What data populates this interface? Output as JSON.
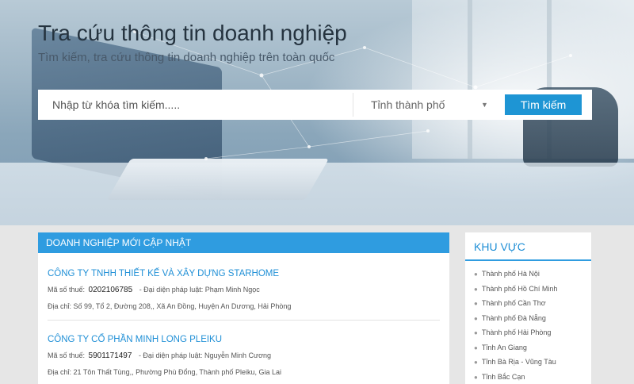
{
  "hero": {
    "title": "Tra cứu thông tin doanh nghiệp",
    "subtitle": "Tìm kiếm, tra cứu thông tin doanh nghiệp trên toàn quốc"
  },
  "search": {
    "placeholder": "Nhập từ khóa tìm kiếm.....",
    "province_select": "Tỉnh thành phố",
    "button": "Tìm kiếm"
  },
  "updates": {
    "header": "DOANH NGHIỆP MỚI CẬP NHẬT",
    "companies": [
      {
        "name": "CÔNG TY TNHH THIẾT KẾ VÀ XÂY DỰNG STARHOME",
        "tax_label": "Mã số thuế:",
        "tax_code": "0202106785",
        "rep_label": "- Đại diện pháp luật:",
        "rep_name": "Phạm Minh Ngọc",
        "address_label": "Địa chỉ:",
        "address": "Số 99, Tổ 2, Đường 208,, Xã An Đồng, Huyện An Dương, Hải Phòng"
      },
      {
        "name": "CÔNG TY CỔ PHẦN MINH LONG PLEIKU",
        "tax_label": "Mã số thuế:",
        "tax_code": "5901171497",
        "rep_label": "- Đại diện pháp luật:",
        "rep_name": "Nguyễn Minh Cương",
        "address_label": "Địa chỉ:",
        "address": "21 Tôn Thất Tùng,, Phường Phù Đổng, Thành phố Pleiku, Gia Lai"
      }
    ]
  },
  "sidebar": {
    "title": "KHU VỰC",
    "regions": [
      "Thành phố Hà Nội",
      "Thành phố Hồ Chí Minh",
      "Thành phố Cần Thơ",
      "Thành phố Đà Nẵng",
      "Thành phố Hải Phòng",
      "Tỉnh An Giang",
      "Tỉnh Bà Rịa - Vũng Tàu",
      "Tỉnh Bắc Cạn"
    ]
  },
  "icons": {
    "select_arrow": "caret-down-icon",
    "bullet": "bullet-icon"
  },
  "colors": {
    "accent": "#1e95d4",
    "header_bar": "#2f9ce0",
    "link": "#1f8fd6",
    "page_bg": "#e6e6e6"
  }
}
